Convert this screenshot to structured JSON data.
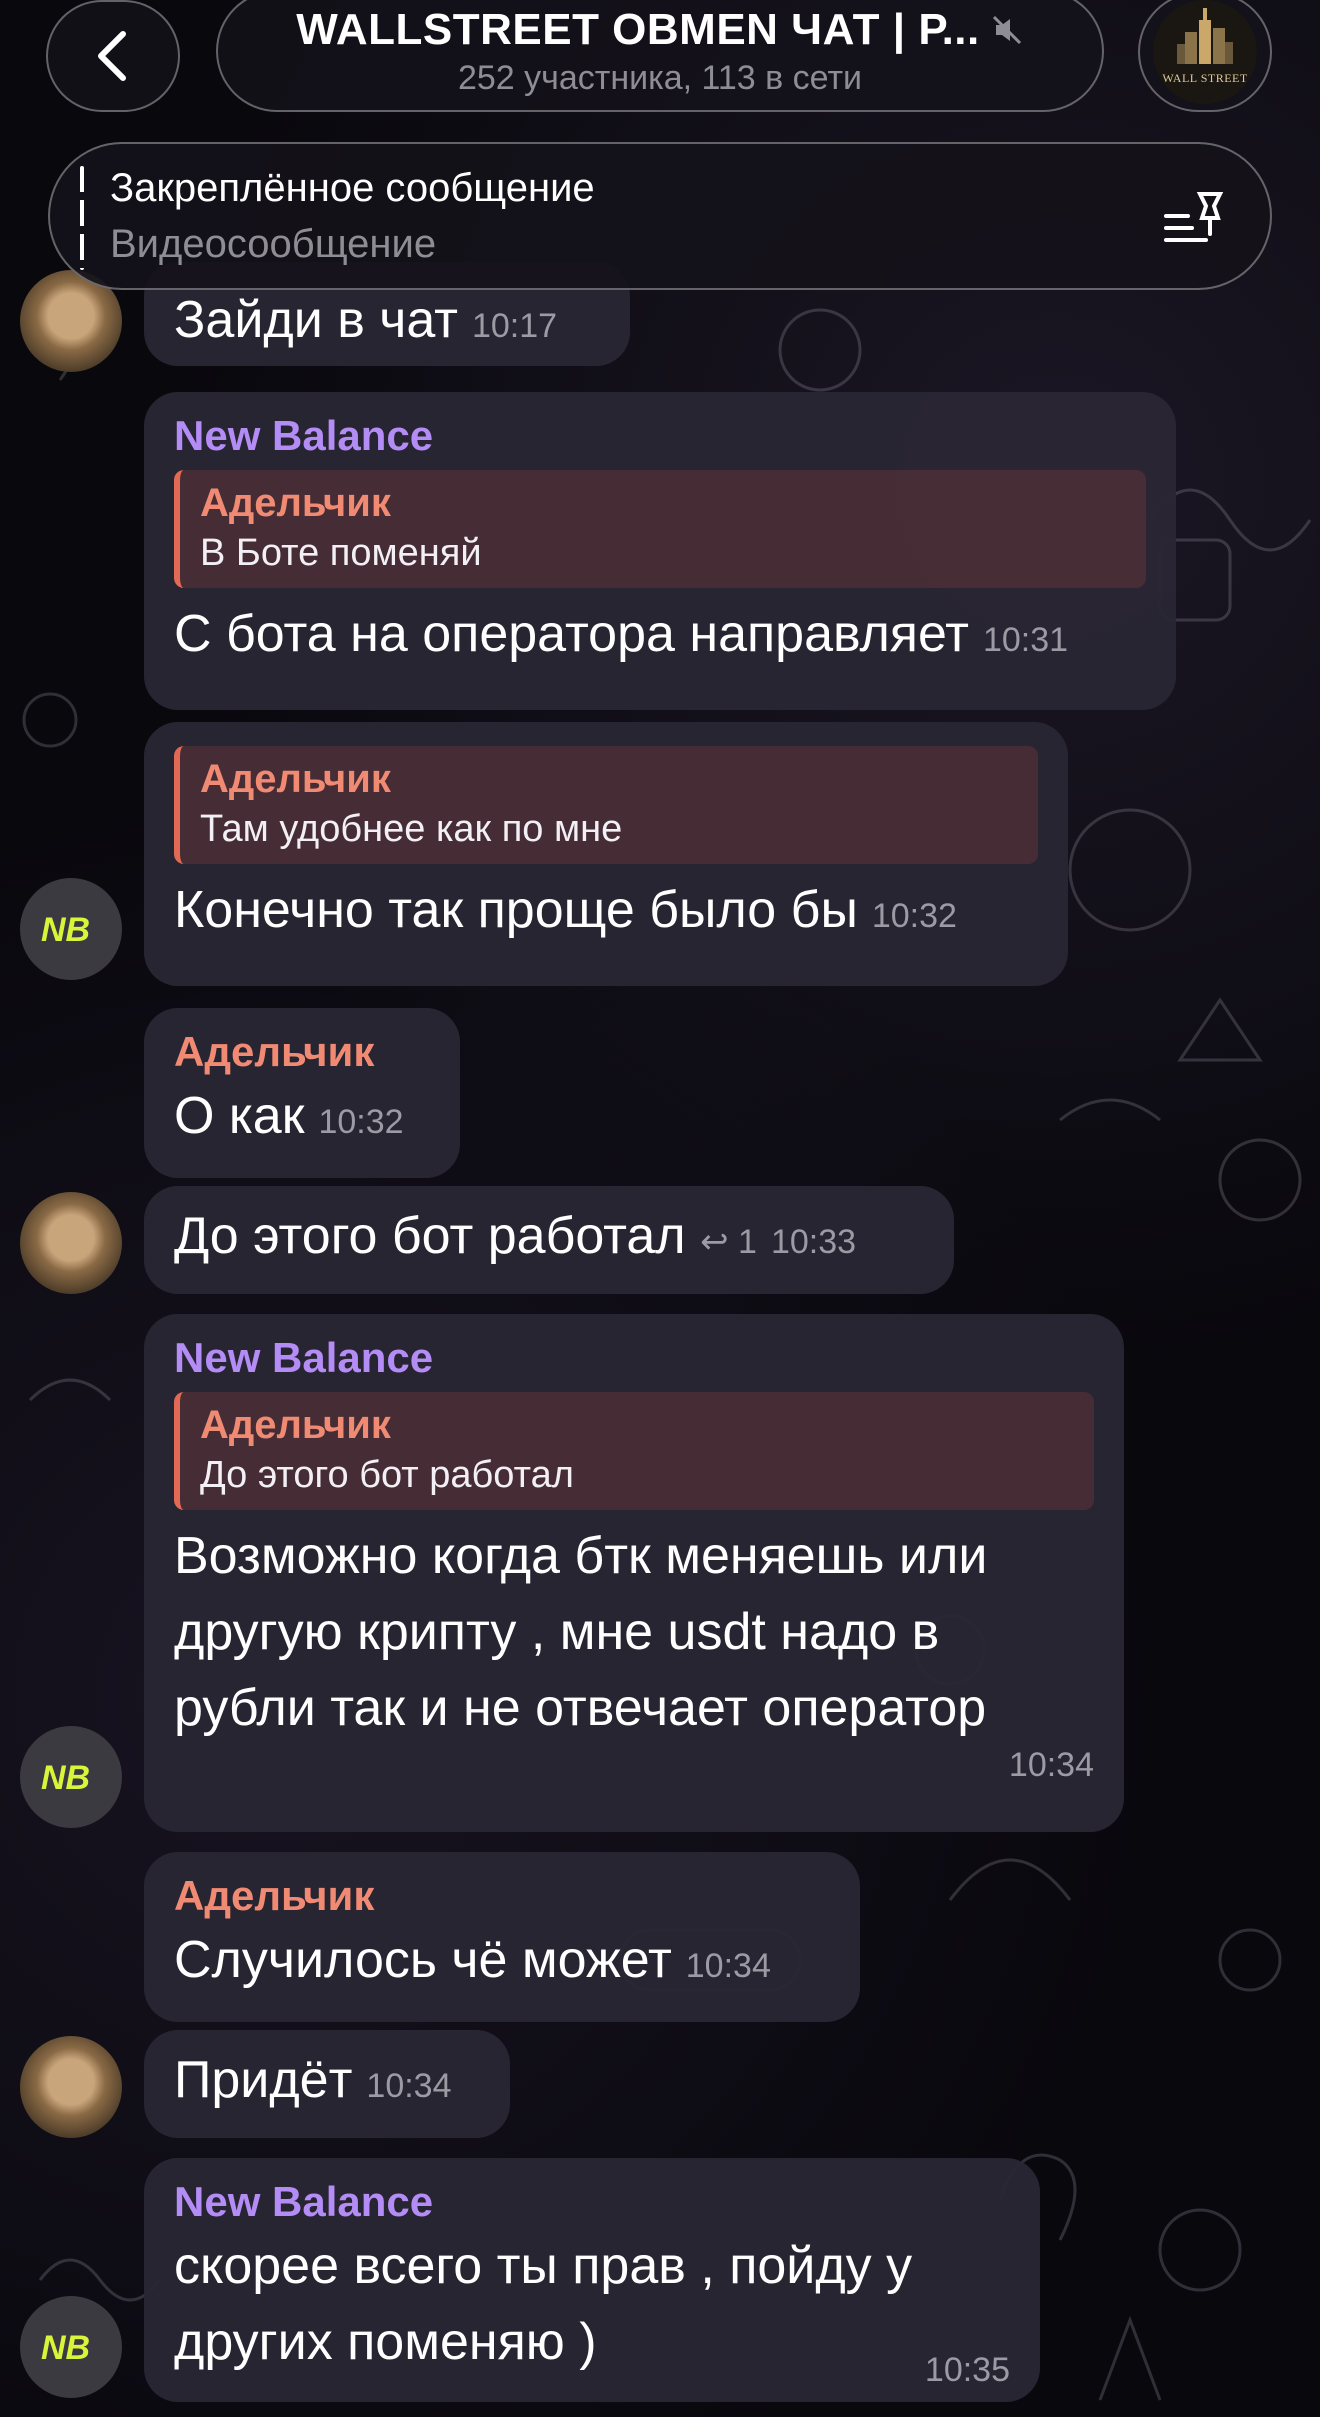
{
  "header": {
    "title": "WALLSTREET OBMEN ЧАТ | Р...",
    "subtitle": "252 участника, 113 в сети",
    "group_avatar_text": "WALL STREET"
  },
  "pinned": {
    "title": "Закреплённое сообщение",
    "text": "Видеосообщение"
  },
  "messages": [
    {
      "text": "Зайди  в чат",
      "time": "10:17"
    },
    {
      "sender": "New Balance",
      "reply_name": "Адельчик",
      "reply_text": "В Боте поменяй",
      "text": "С бота на оператора направляет",
      "time": "10:31"
    },
    {
      "reply_name": "Адельчик",
      "reply_text": "Там удобнее как по мне",
      "text": "Конечно так проще было бы",
      "time": "10:32"
    },
    {
      "sender": "Адельчик",
      "text": "О как",
      "time": "10:32"
    },
    {
      "text": "До этого бот работал",
      "replies": "1",
      "time": "10:33"
    },
    {
      "sender": "New Balance",
      "reply_name": "Адельчик",
      "reply_text": "До этого бот работал",
      "text": "Возможно когда бтк меняешь или другую крипту , мне usdt надо в рубли так и не отвечает оператор",
      "time": "10:34"
    },
    {
      "sender": "Адельчик",
      "text": "Случилось чё может",
      "time": "10:34"
    },
    {
      "text": "Придёт",
      "time": "10:34"
    },
    {
      "sender": "New Balance",
      "text": "скорее всего ты прав , пойду у других поменяю )",
      "time": "10:35"
    }
  ],
  "colors": {
    "accent_purple": "#b48cf5",
    "accent_orange": "#f08a73",
    "bubble": "#2a2634"
  }
}
